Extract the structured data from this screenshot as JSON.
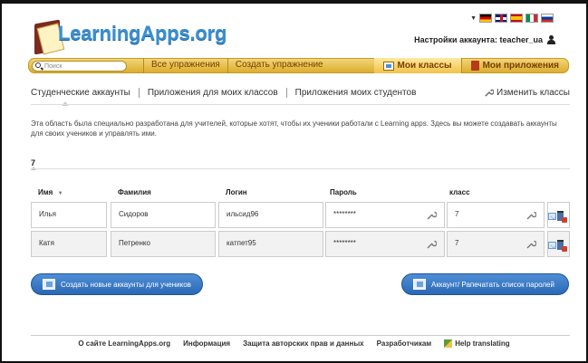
{
  "header": {
    "logo_text": "LearningApps.org",
    "account_label": "Настройки аккаунта: teacher_ua",
    "flags": [
      "de-flag",
      "uk-flag",
      "es-flag",
      "it-flag",
      "ru-flag"
    ]
  },
  "nav": {
    "search_placeholder": "Поиск",
    "left_items": [
      "Все упражнения",
      "Создать упражнение"
    ],
    "my_classes": "Мои классы",
    "my_apps": "Мои приложения"
  },
  "subtabs": {
    "items": [
      "Студенческие аккаунты",
      "Приложения для моих классов",
      "Приложения моих студентов"
    ],
    "edit_classes": "Изменить классы"
  },
  "description": "Эта область была специально разработана для учителей, которые хотят, чтобы их ученики работали с Learning apps. Здесь вы можете создавать аккаунты для своих учеников и управлять ими.",
  "class_count": "7",
  "table": {
    "headers": {
      "name": "Имя",
      "sort_marker": "▼",
      "surname": "Фамилия",
      "login": "Логин",
      "password": "Пароль",
      "class": "класс"
    },
    "rows": [
      {
        "name": "Илья",
        "surname": "Сидоров",
        "login": "ильсид96",
        "password": "********",
        "class": "7"
      },
      {
        "name": "Катя",
        "surname": "Петренко",
        "login": "катпет95",
        "password": "********",
        "class": "7"
      }
    ]
  },
  "buttons": {
    "create_accounts": "Создать новые аккаунты для учеников",
    "print_passwords": "Аккаунт/ Рапечатать список паролей"
  },
  "footer": {
    "about": "О сайте LearningApps.org",
    "info": "Информация",
    "copyright": "Защита авторских прав и данных",
    "developers": "Разработчикам",
    "help": "Help translating"
  },
  "colors": {
    "nav_gold": "#dcae2d",
    "nav_text": "#7a3e00",
    "logo_blue": "#3a8fd1",
    "button_blue": "#2a68b5"
  }
}
